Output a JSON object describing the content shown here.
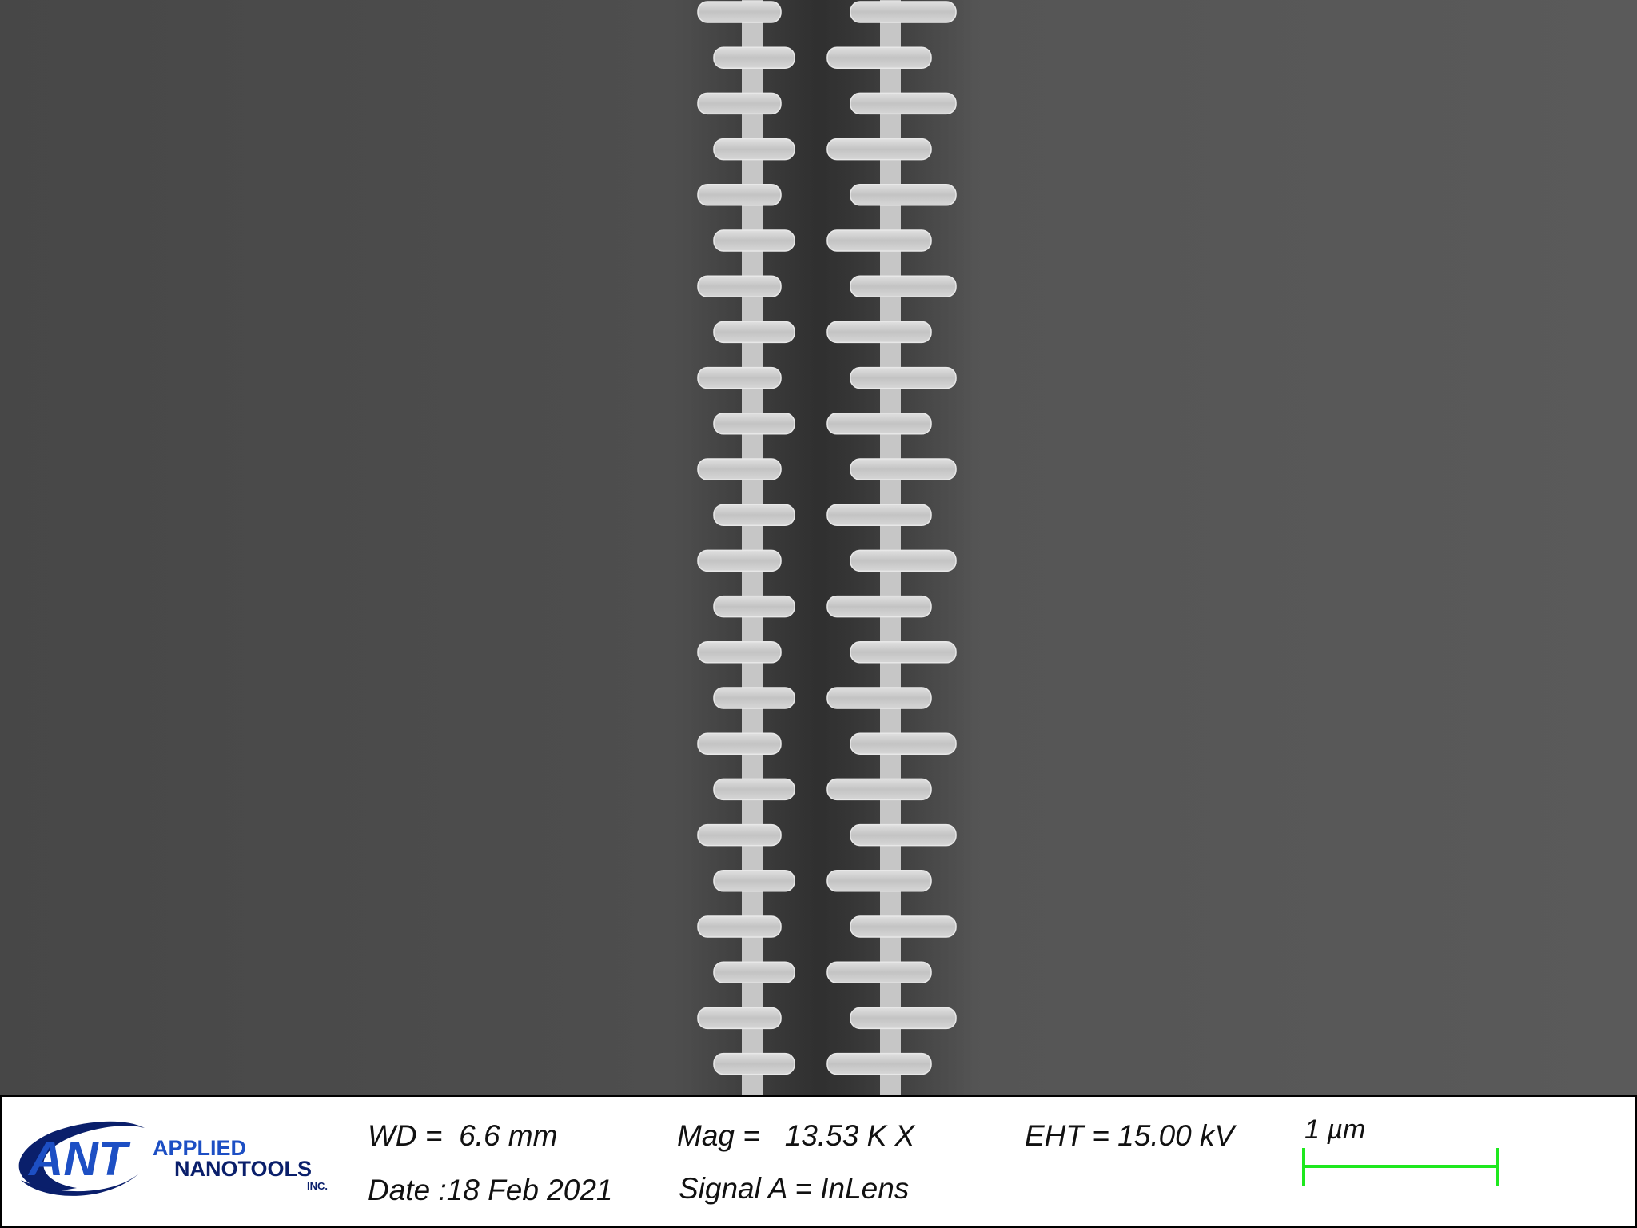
{
  "logo": {
    "mark": "ANT",
    "line1": "APPLIED",
    "line2": "NANOTOOLS",
    "suffix": "INC.",
    "mark_color": "#1d4fc4",
    "swoosh_color": "#0a1f6b"
  },
  "info": {
    "wd": "WD =  6.6 mm",
    "date": "Date :18 Feb 2021",
    "mag": "Mag =   13.53 K X",
    "signal": "Signal A = InLens",
    "eht": "EHT = 15.00 kV"
  },
  "scale_bar": {
    "label": "1 µm",
    "color": "#1ee81e"
  },
  "colors": {
    "background": "#4a4a4a",
    "structure": "#c4c4c4"
  }
}
